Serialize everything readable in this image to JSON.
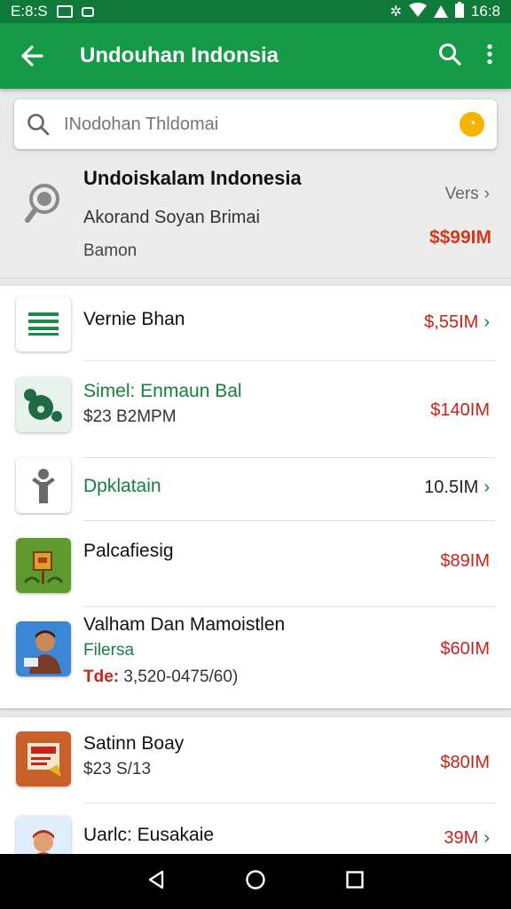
{
  "status_bar": {
    "left_text": "E:8:S",
    "right_text": "16:8"
  },
  "app_bar": {
    "title": "Undouhan Indonsia"
  },
  "search": {
    "placeholder": "INodohan Thldomai"
  },
  "featured": {
    "title": "Undoiskalam Indonesia",
    "subtitle": "Akorand Soyan Brimai",
    "subtitle2": "Bamon",
    "more_label": "Vers",
    "price": "$$99IM"
  },
  "list1": [
    {
      "title": "Vernie Bhan",
      "subtitle": "",
      "price": "$,55IM",
      "icon": "menu-list-icon"
    },
    {
      "title": "Simel: Enmaun Bal",
      "subtitle": "$23 B2MPM",
      "price": "$140IM",
      "icon": "green-blob-icon"
    },
    {
      "title": "Dpklatain",
      "subtitle": "",
      "price": "10.5IM",
      "icon": "person-figure-icon"
    },
    {
      "title": "Palcafiesig",
      "subtitle": "",
      "price": "$89IM",
      "icon": "mailbox-icon"
    },
    {
      "title": "Valham Dan Mamoistlen",
      "subtitle": "Filersa",
      "detail_label": "Tde:",
      "detail_value": " 3,520-0475/60)",
      "price": "$60IM",
      "icon": "man-avatar-icon"
    }
  ],
  "list2": [
    {
      "title": "Satinn Boay",
      "subtitle": "$23 S/13",
      "price": "$80IM",
      "icon": "book-icon"
    },
    {
      "title": "Uarlc: Eusakaie",
      "subtitle": "",
      "price": "39M",
      "icon": "boy-avatar-icon"
    }
  ],
  "colors": {
    "app_bar": "#159a47",
    "status_bar": "#0f7a3a",
    "price_red": "#c8231a",
    "green_text": "#15803d"
  }
}
